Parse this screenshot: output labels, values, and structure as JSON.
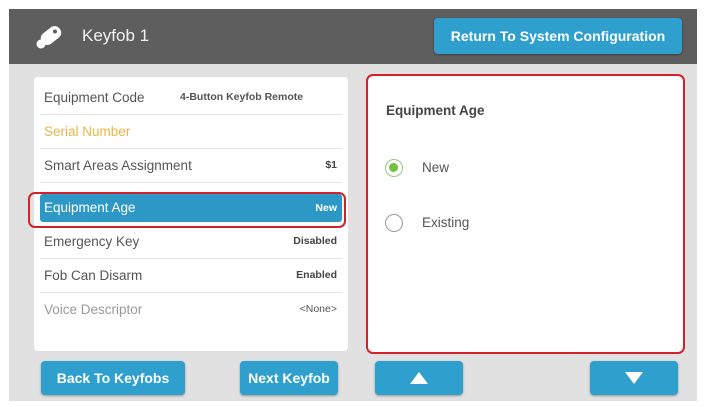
{
  "header": {
    "title": "Keyfob 1",
    "icon": "keyfob-icon",
    "return_button": "Return To System Configuration"
  },
  "equipment_list": [
    {
      "label": "Equipment Code",
      "value": "4-Button Keyfob Remote"
    },
    {
      "label": "Serial Number",
      "value": ""
    },
    {
      "label": "Smart Areas Assignment",
      "value": "$1"
    },
    {
      "label": "Equipment Age",
      "value": "New",
      "selected": true
    },
    {
      "label": "Emergency Key",
      "value": "Disabled"
    },
    {
      "label": "Fob Can Disarm",
      "value": "Enabled"
    },
    {
      "label": "Voice Descriptor",
      "value": "<None>"
    }
  ],
  "detail": {
    "title": "Equipment Age",
    "options": [
      {
        "label": "New",
        "checked": true
      },
      {
        "label": "Existing",
        "checked": false
      }
    ]
  },
  "footer": {
    "back_button": "Back To Keyfobs",
    "next_button": "Next Keyfob",
    "up_icon": "arrow-up-icon",
    "down_icon": "arrow-down-icon"
  },
  "colors": {
    "accent": "#2f9fcd",
    "header_bg": "#5e5e5e",
    "highlight_border": "#d4202a",
    "serial_label": "#e8b548",
    "radio_selected": "#75c043"
  }
}
